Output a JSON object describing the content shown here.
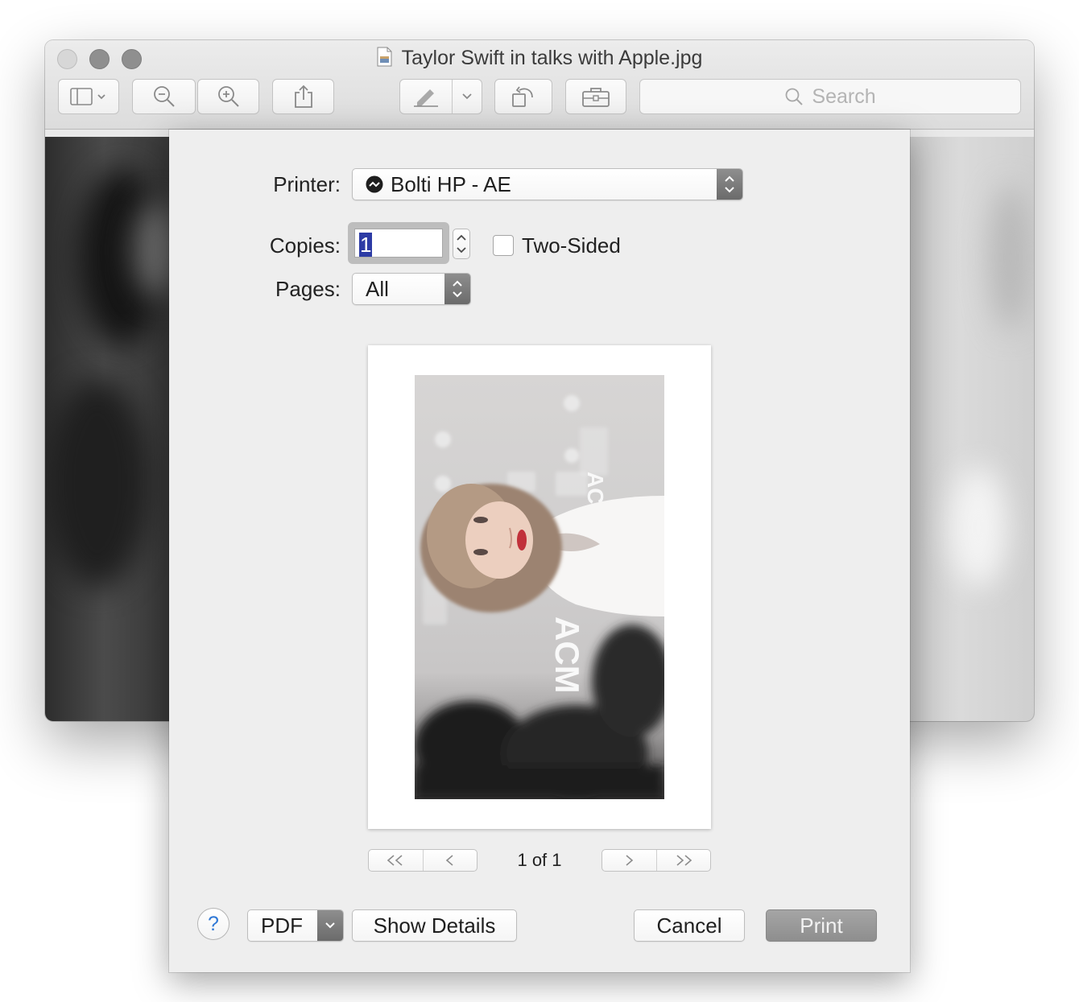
{
  "window": {
    "title": "Taylor Swift in talks with Apple.jpg",
    "toolbar": {
      "sidebar_icon": "sidebar-icon",
      "zoom_out_icon": "zoom-out-icon",
      "zoom_in_icon": "zoom-in-icon",
      "share_icon": "share-icon",
      "markup_icon": "pen-icon",
      "rotate_icon": "rotate-icon",
      "toolbox_icon": "toolbox-icon",
      "search_placeholder": "Search"
    }
  },
  "print_dialog": {
    "printer_label": "Printer:",
    "printer_value": "Bolti HP - AE",
    "copies_label": "Copies:",
    "copies_value": "1",
    "two_sided_label": "Two-Sided",
    "two_sided_checked": false,
    "pages_label": "Pages:",
    "pages_value": "All",
    "page_count": "1 of 1",
    "help_label": "?",
    "pdf_label": "PDF",
    "show_details_label": "Show Details",
    "cancel_label": "Cancel",
    "print_label": "Print"
  },
  "colors": {
    "selection": "#2d3ba5",
    "help_accent": "#2f78d6",
    "print_button": "#9a9a9a"
  }
}
